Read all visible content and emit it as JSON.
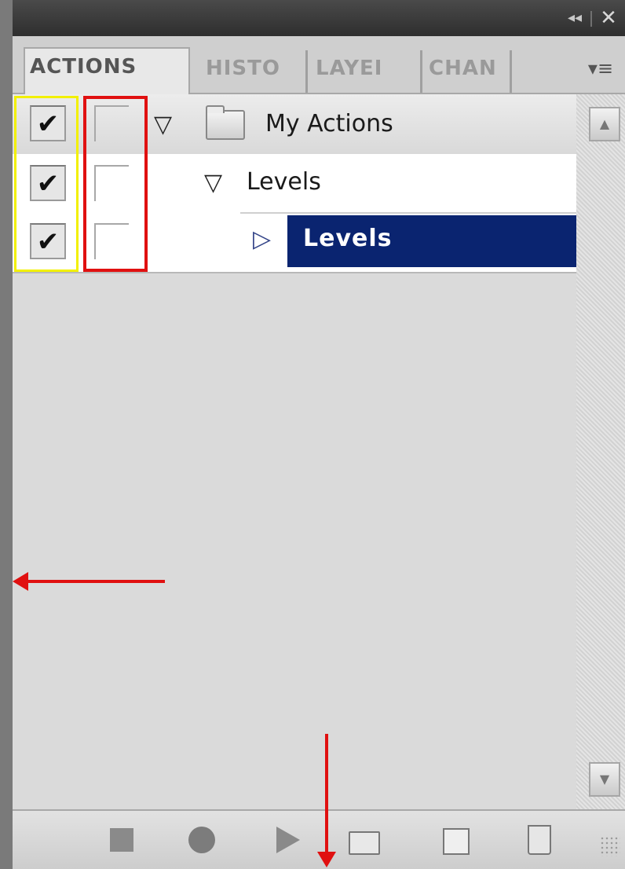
{
  "titlebar": {
    "collapse_glyph": "◂◂",
    "close_glyph": "✕"
  },
  "tabs": [
    {
      "label": "ACTIONS",
      "active": true
    },
    {
      "label": "HISTO",
      "active": false
    },
    {
      "label": "LAYEI",
      "active": false
    },
    {
      "label": "CHAN",
      "active": false
    }
  ],
  "panel_menu_glyph": "▾≡",
  "actions": {
    "rows": [
      {
        "label": "My Actions",
        "checked": "✔",
        "type": "set",
        "expanded": "▽"
      },
      {
        "label": "Levels",
        "checked": "✔",
        "type": "action",
        "expanded": "▽"
      },
      {
        "label": "Levels",
        "checked": "✔",
        "type": "step",
        "expanded": "▷",
        "selected": true
      }
    ]
  },
  "toolbar": {
    "icons": [
      "stop-icon",
      "record-icon",
      "play-icon",
      "new-set-icon",
      "new-action-icon",
      "delete-icon"
    ]
  },
  "colors": {
    "selection": "#0a2470",
    "annotation_yellow": "#f2f000",
    "annotation_red": "#e01010"
  }
}
